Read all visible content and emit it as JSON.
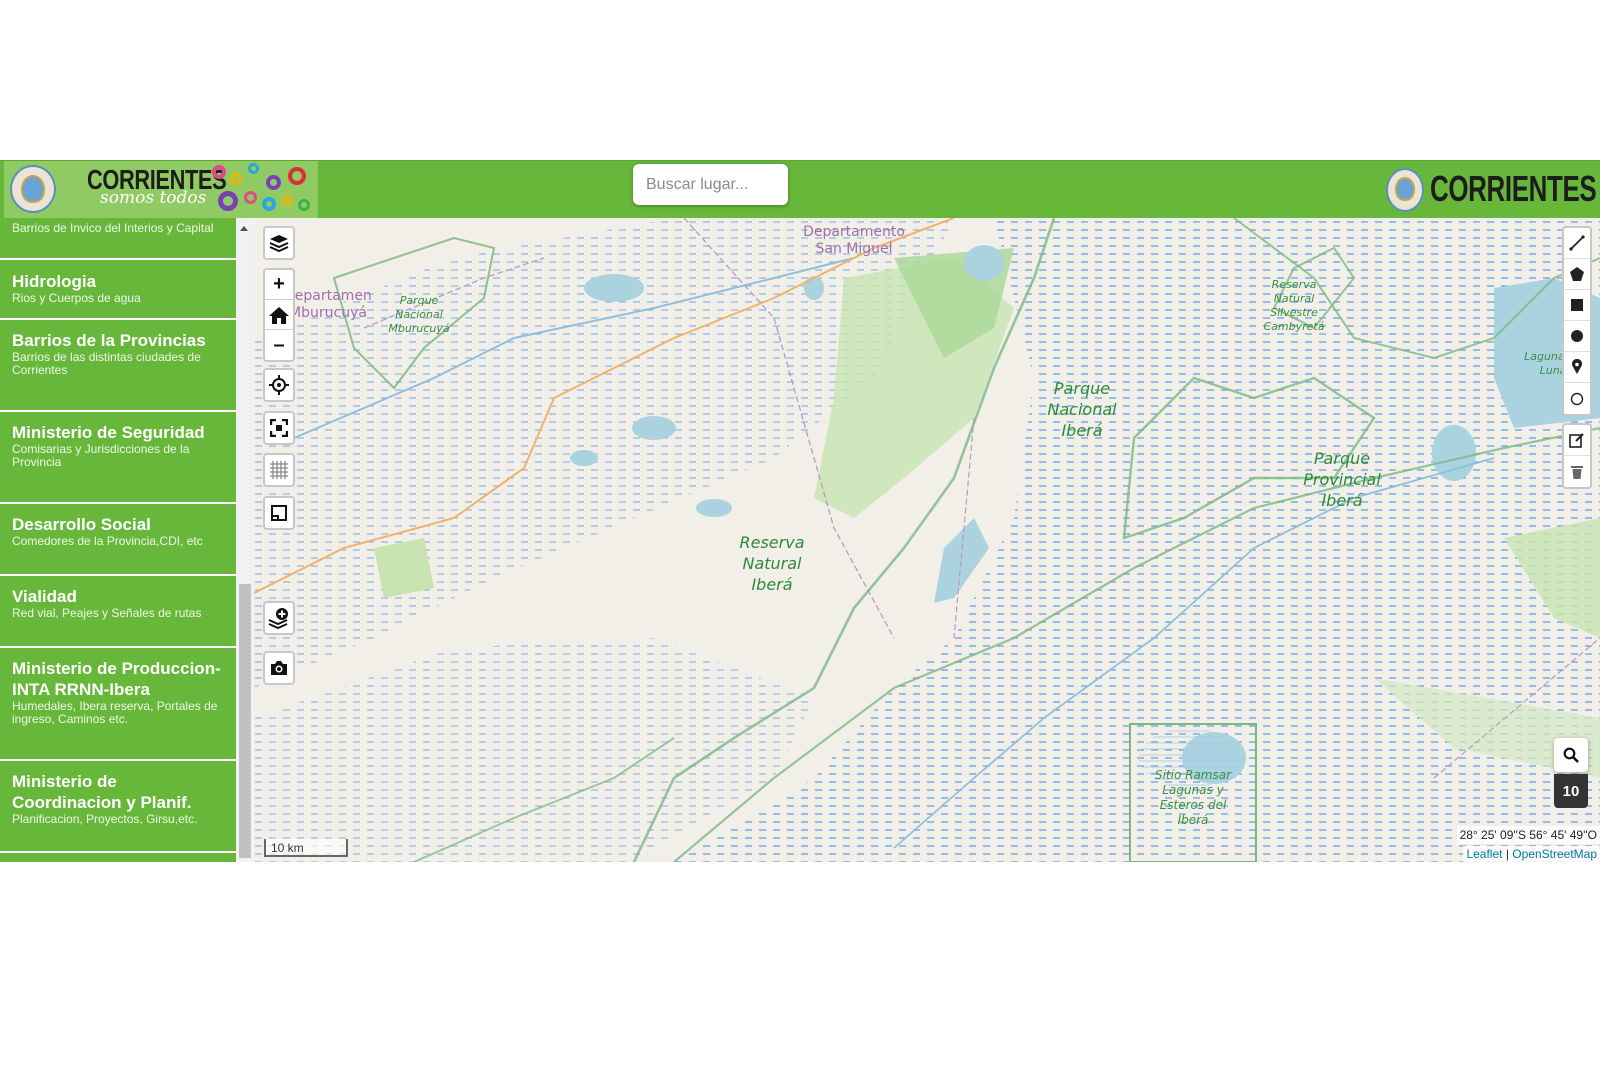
{
  "header": {
    "brand_left_word": "CORRIENTES",
    "brand_left_slogan": "somos todos",
    "brand_right_word": "CORRIENTES",
    "search": {
      "placeholder": "Buscar lugar..."
    }
  },
  "sidebar": {
    "partial_top_sub": "Barrios de Invico del Interios y Capital",
    "items": [
      {
        "title": "Hidrologia",
        "sub": "Rios y Cuerpos de agua"
      },
      {
        "title": "Barrios de la Provincias",
        "sub": "Barrios de las distintas ciudades de Corrientes"
      },
      {
        "title": "Ministerio de Seguridad",
        "sub": "Comisarias y Jurisdicciones de la Provincia"
      },
      {
        "title": "Desarrollo Social",
        "sub": "Comedores de la Provincia,CDI, etc"
      },
      {
        "title": "Vialidad",
        "sub": "Red vial, Peajes y Señales de rutas"
      },
      {
        "title": "Ministerio de Produccion-INTA RRNN-Ibera",
        "sub": "Humedales, Ibera reserva, Portales de ingreso, Caminos etc."
      },
      {
        "title": "Ministerio de Coordinacion y Planif.",
        "sub": "Planificacion, Proyectos, Girsu,etc."
      }
    ]
  },
  "map": {
    "labels": {
      "dept_san_miguel": "Departamento San Miguel",
      "dept_mburucuya": "Departamento Mburucuyá",
      "parque_mburucuya": "Parque Nacional Mburucuyá",
      "reserva_cambyreta": "Reserva Natural Silvestre Cambyretá",
      "laguna_luna": "Laguna de Luna",
      "parque_ibera": "Parque Nacional Iberá",
      "parque_provincial": "Parque Provincial Iberá",
      "reserva_ibera": "Reserva Natural Iberá",
      "sitio_ramsar": "Sitio Ramsar Lagunas y Esteros del Iberá"
    },
    "scale": "10 km",
    "coordinates": "28° 25' 09''S 56° 45' 49''O",
    "zoom_level": "10",
    "attribution": {
      "leaflet": "Leaflet",
      "separator": " | ",
      "osm": "OpenStreetMap"
    },
    "left_controls": [
      "layers-icon",
      "zoom-in-icon",
      "home-icon",
      "zoom-out-icon",
      "locate-icon",
      "fullscreen-icon",
      "grid-icon",
      "minimap-icon",
      "add-layer-icon",
      "camera-icon"
    ],
    "draw_controls": [
      "polyline-icon",
      "polygon-icon",
      "rectangle-icon",
      "circle-icon",
      "marker-icon",
      "circle-marker-icon",
      "edit-icon",
      "delete-icon"
    ]
  }
}
